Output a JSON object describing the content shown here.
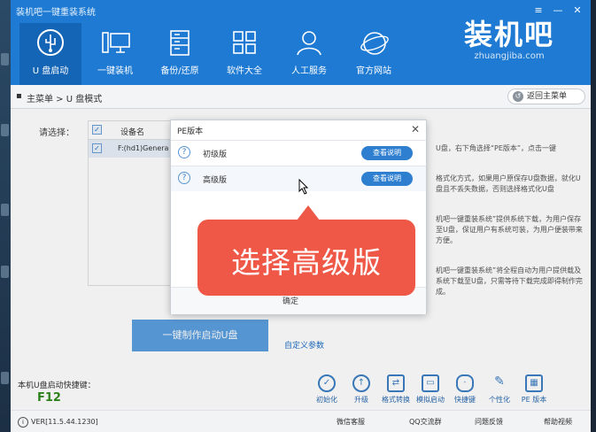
{
  "app": {
    "title": "装机吧一键重装系统",
    "brand_name": "装机吧",
    "brand_url": "zhuangjiba.com",
    "colors": {
      "primary": "#1e7ad3",
      "accent": "#ef5847",
      "green": "#2f8a1d"
    }
  },
  "nav": {
    "items": [
      {
        "label": "U 盘启动",
        "icon": "usb-icon",
        "active": true
      },
      {
        "label": "一键装机",
        "icon": "monitor-icon",
        "active": false
      },
      {
        "label": "备份/还原",
        "icon": "backup-icon",
        "active": false
      },
      {
        "label": "软件大全",
        "icon": "apps-grid-icon",
        "active": false
      },
      {
        "label": "人工服务",
        "icon": "support-person-icon",
        "active": false
      },
      {
        "label": "官方网站",
        "icon": "globe-icon",
        "active": false
      }
    ]
  },
  "breadcrumb": {
    "text": "主菜单 > U 盘模式",
    "back_label": "返回主菜单"
  },
  "main": {
    "select_label": "请选择：",
    "table_header": "设备名",
    "device_row": "F:(hd1)Genera",
    "info": [
      "U盘，右下角选择“PE版本”，点击一键",
      "格式化方式，如果用户原保存U盘数据，就化U盘且不丢失数据，否则选择格式化U盘",
      "机吧一键重装系统”提供系统下载，为用户保存至U盘，保证用户有系统可装，为用户便装带来方便。",
      "机吧一键重装系统”将全程自动为用户提供载及系统下载至U盘，只需等待下载完成即得制作完成。"
    ],
    "make_button": "一键制作启动U盘",
    "custom_params": "自定义参数"
  },
  "shortcut": {
    "label": "本机U盘启动快捷键：",
    "key": "F12"
  },
  "tools": [
    {
      "label": "初始化",
      "icon": "init-icon"
    },
    {
      "label": "升级",
      "icon": "upgrade-icon"
    },
    {
      "label": "格式转换",
      "icon": "convert-icon"
    },
    {
      "label": "模拟启动",
      "icon": "simulate-icon"
    },
    {
      "label": "快捷键",
      "icon": "mouse-icon"
    },
    {
      "label": "个性化",
      "icon": "brush-icon"
    },
    {
      "label": "PE 版本",
      "icon": "pe-icon"
    }
  ],
  "status": {
    "version": "VER[11.5.44.1230]",
    "links": [
      "微信客服",
      "QQ交流群",
      "问题反馈",
      "帮助视频"
    ]
  },
  "modal": {
    "title": "PE版本",
    "rows": [
      {
        "name": "初级版",
        "button": "查看说明"
      },
      {
        "name": "高级版",
        "button": "查看说明"
      }
    ],
    "ok": "确定"
  },
  "callout": {
    "text": "选择高级版"
  }
}
